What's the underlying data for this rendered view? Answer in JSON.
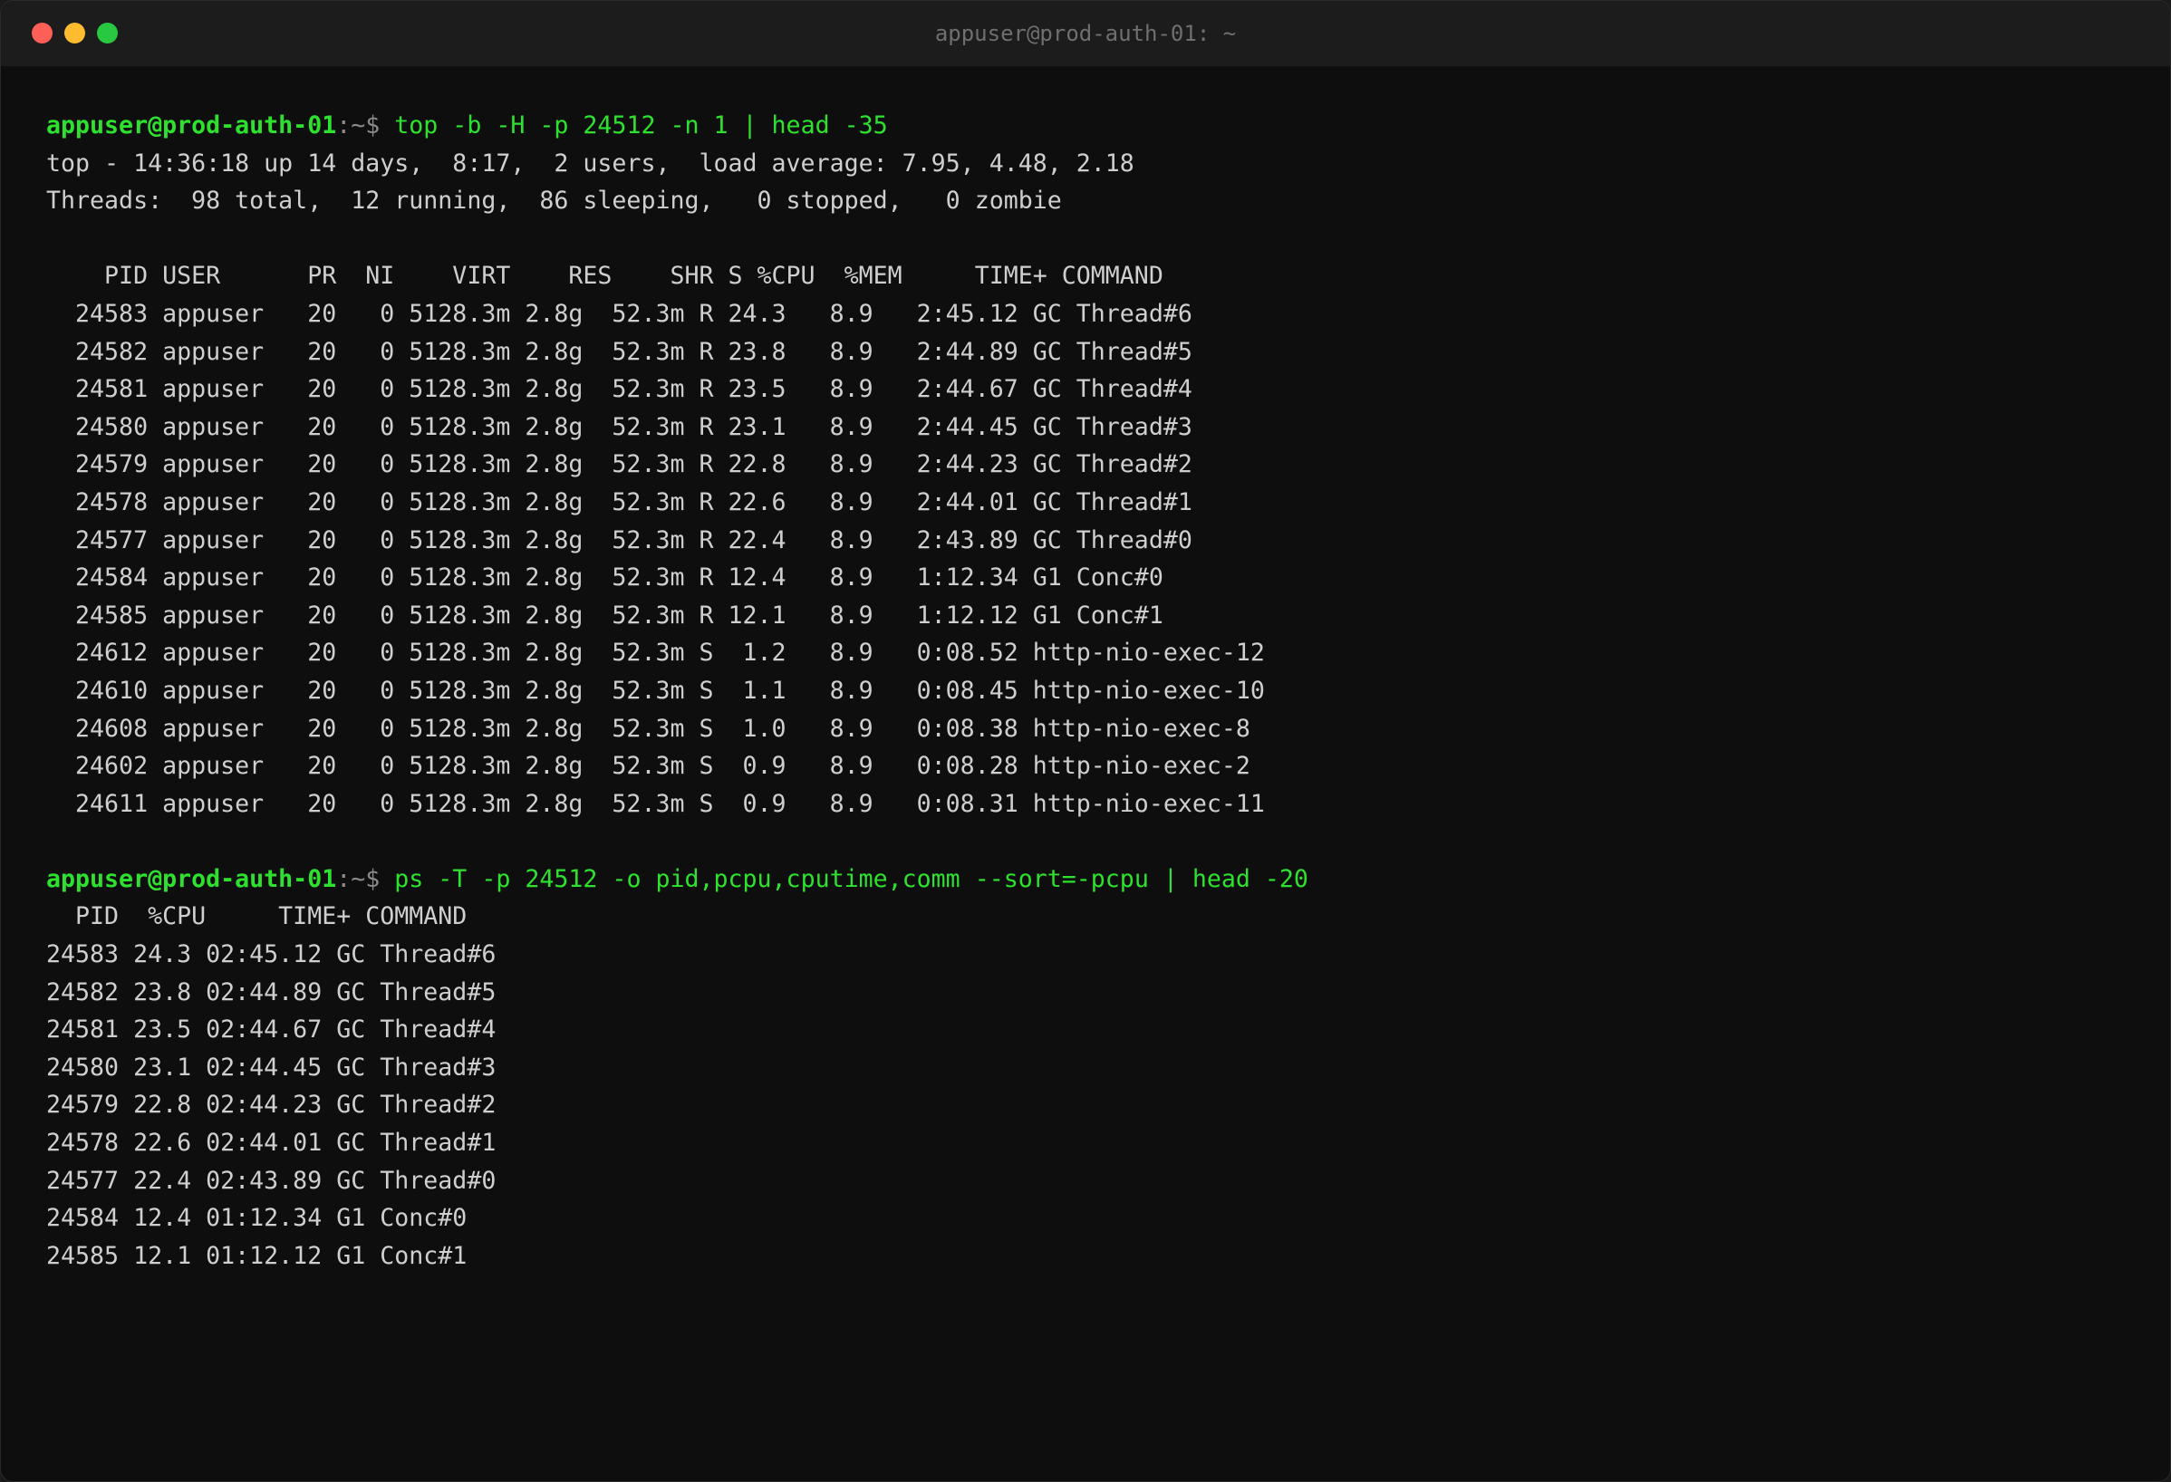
{
  "window": {
    "title": "appuser@prod-auth-01: ~"
  },
  "prompt": {
    "user_host": "appuser@prod-auth-01",
    "path": ":~$ "
  },
  "blocks": [
    {
      "command": "top -b -H -p 24512 -n 1 | head -35",
      "output": [
        "top - 14:36:18 up 14 days,  8:17,  2 users,  load average: 7.95, 4.48, 2.18",
        "Threads:  98 total,  12 running,  86 sleeping,   0 stopped,   0 zombie",
        "",
        "    PID USER      PR  NI    VIRT    RES    SHR S %CPU  %MEM     TIME+ COMMAND",
        "  24583 appuser   20   0 5128.3m 2.8g  52.3m R 24.3   8.9   2:45.12 GC Thread#6",
        "  24582 appuser   20   0 5128.3m 2.8g  52.3m R 23.8   8.9   2:44.89 GC Thread#5",
        "  24581 appuser   20   0 5128.3m 2.8g  52.3m R 23.5   8.9   2:44.67 GC Thread#4",
        "  24580 appuser   20   0 5128.3m 2.8g  52.3m R 23.1   8.9   2:44.45 GC Thread#3",
        "  24579 appuser   20   0 5128.3m 2.8g  52.3m R 22.8   8.9   2:44.23 GC Thread#2",
        "  24578 appuser   20   0 5128.3m 2.8g  52.3m R 22.6   8.9   2:44.01 GC Thread#1",
        "  24577 appuser   20   0 5128.3m 2.8g  52.3m R 22.4   8.9   2:43.89 GC Thread#0",
        "  24584 appuser   20   0 5128.3m 2.8g  52.3m R 12.4   8.9   1:12.34 G1 Conc#0",
        "  24585 appuser   20   0 5128.3m 2.8g  52.3m R 12.1   8.9   1:12.12 G1 Conc#1",
        "  24612 appuser   20   0 5128.3m 2.8g  52.3m S  1.2   8.9   0:08.52 http-nio-exec-12",
        "  24610 appuser   20   0 5128.3m 2.8g  52.3m S  1.1   8.9   0:08.45 http-nio-exec-10",
        "  24608 appuser   20   0 5128.3m 2.8g  52.3m S  1.0   8.9   0:08.38 http-nio-exec-8",
        "  24602 appuser   20   0 5128.3m 2.8g  52.3m S  0.9   8.9   0:08.28 http-nio-exec-2",
        "  24611 appuser   20   0 5128.3m 2.8g  52.3m S  0.9   8.9   0:08.31 http-nio-exec-11",
        ""
      ]
    },
    {
      "command": "ps -T -p 24512 -o pid,pcpu,cputime,comm --sort=-pcpu | head -20",
      "output": [
        "  PID  %CPU     TIME+ COMMAND",
        "24583 24.3 02:45.12 GC Thread#6",
        "24582 23.8 02:44.89 GC Thread#5",
        "24581 23.5 02:44.67 GC Thread#4",
        "24580 23.1 02:44.45 GC Thread#3",
        "24579 22.8 02:44.23 GC Thread#2",
        "24578 22.6 02:44.01 GC Thread#1",
        "24577 22.4 02:43.89 GC Thread#0",
        "24584 12.4 01:12.34 G1 Conc#0",
        "24585 12.1 01:12.12 G1 Conc#1"
      ]
    }
  ],
  "colors": {
    "prompt": "#2ee12e",
    "text": "#cfcfcf",
    "background": "#0e0e0e"
  }
}
